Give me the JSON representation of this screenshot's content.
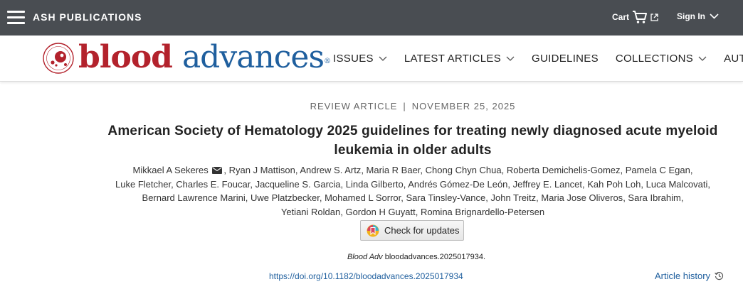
{
  "topbar": {
    "brand": "ASH PUBLICATIONS",
    "cart_label": "Cart",
    "signin_label": "Sign In"
  },
  "logo": {
    "blood": "blood",
    "advances": "advances",
    "registered": "®"
  },
  "nav": {
    "items": [
      {
        "label": "ISSUES",
        "dropdown": true
      },
      {
        "label": "LATEST ARTICLES",
        "dropdown": true
      },
      {
        "label": "GUIDELINES",
        "dropdown": false
      },
      {
        "label": "COLLECTIONS",
        "dropdown": true
      },
      {
        "label": "AUT",
        "dropdown": false
      }
    ]
  },
  "article": {
    "type": "REVIEW ARTICLE",
    "separator": "|",
    "date": "NOVEMBER 25, 2025",
    "title": "American Society of Hematology 2025 guidelines for treating newly diagnosed acute myeloid leukemia in older adults",
    "authors": [
      "Mikkael A Sekeres",
      "Ryan J Mattison",
      "Andrew S. Artz",
      "Maria R Baer",
      "Chong Chyn Chua",
      "Roberta Demichelis-Gomez",
      "Pamela C Egan",
      "Luke Fletcher",
      "Charles E. Foucar",
      "Jacqueline S. Garcia",
      "Linda Gilberto",
      "Andrés Gómez-De León",
      "Jeffrey E. Lancet",
      "Kah Poh Loh",
      "Luca Malcovati",
      "Bernard Lawrence Marini",
      "Uwe Platzbecker",
      "Mohamed L Sorror",
      "Sara Tinsley-Vance",
      "John Treitz",
      "Maria Jose Oliveros",
      "Sara Ibrahim",
      "Yetiani Roldan",
      "Gordon H Guyatt",
      "Romina Brignardello-Petersen"
    ],
    "check_updates_label": "Check for updates",
    "citation_journal": "Blood Adv",
    "citation_id": "bloodadvances.2025017934.",
    "doi": "https://doi.org/10.1182/bloodadvances.2025017934",
    "history_label": "Article history"
  },
  "colors": {
    "topbar_bg": "#494d52",
    "brand_red": "#b3222c",
    "brand_blue": "#1f5f9e",
    "link_blue": "#1f5f9e"
  }
}
